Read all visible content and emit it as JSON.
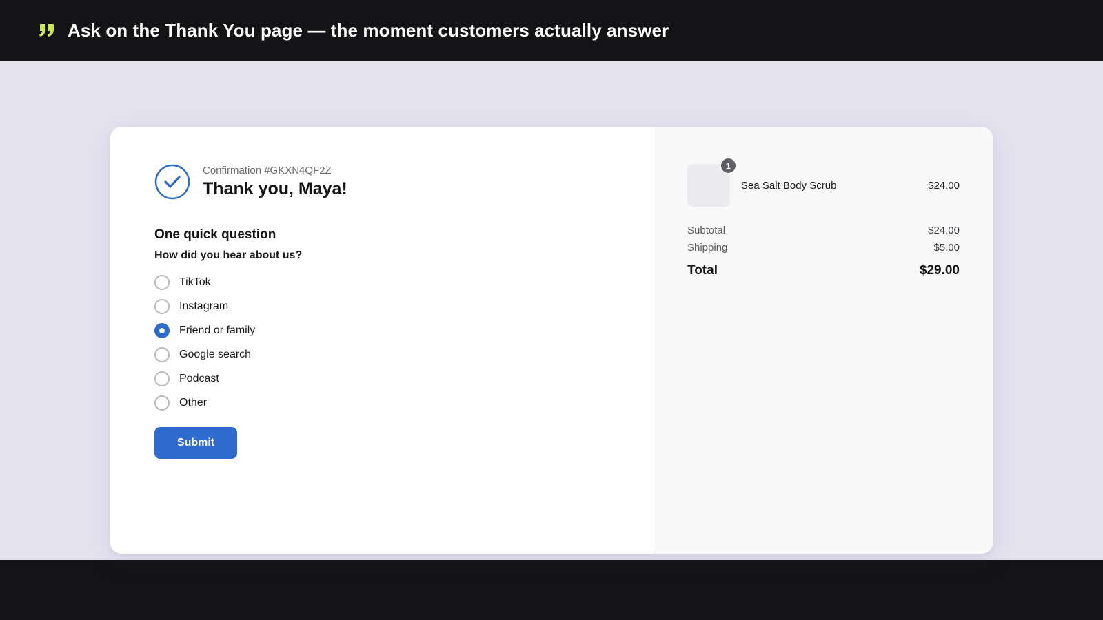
{
  "headline": {
    "text": "Ask on the Thank You page — the moment customers actually answer",
    "quote_icon": "quote-icon",
    "accent_color": "#c8e64a"
  },
  "confirmation": {
    "number": "Confirmation #GKXN4QF2Z",
    "title": "Thank you, Maya!",
    "icon": "check-circle-icon"
  },
  "survey": {
    "title": "One quick question",
    "question": "How did you hear about us?",
    "options": [
      {
        "label": "TikTok",
        "selected": false
      },
      {
        "label": "Instagram",
        "selected": false
      },
      {
        "label": "Friend or family",
        "selected": true
      },
      {
        "label": "Google search",
        "selected": false
      },
      {
        "label": "Podcast",
        "selected": false
      },
      {
        "label": "Other",
        "selected": false
      }
    ],
    "submit_label": "Submit"
  },
  "order": {
    "item": {
      "quantity": "1",
      "name": "Sea Salt Body Scrub",
      "price": "$24.00"
    },
    "subtotal_label": "Subtotal",
    "subtotal_value": "$24.00",
    "shipping_label": "Shipping",
    "shipping_value": "$5.00",
    "total_label": "Total",
    "total_value": "$29.00"
  },
  "colors": {
    "primary": "#2d6bcf",
    "background": "#e6e3f0",
    "dark": "#141417"
  }
}
